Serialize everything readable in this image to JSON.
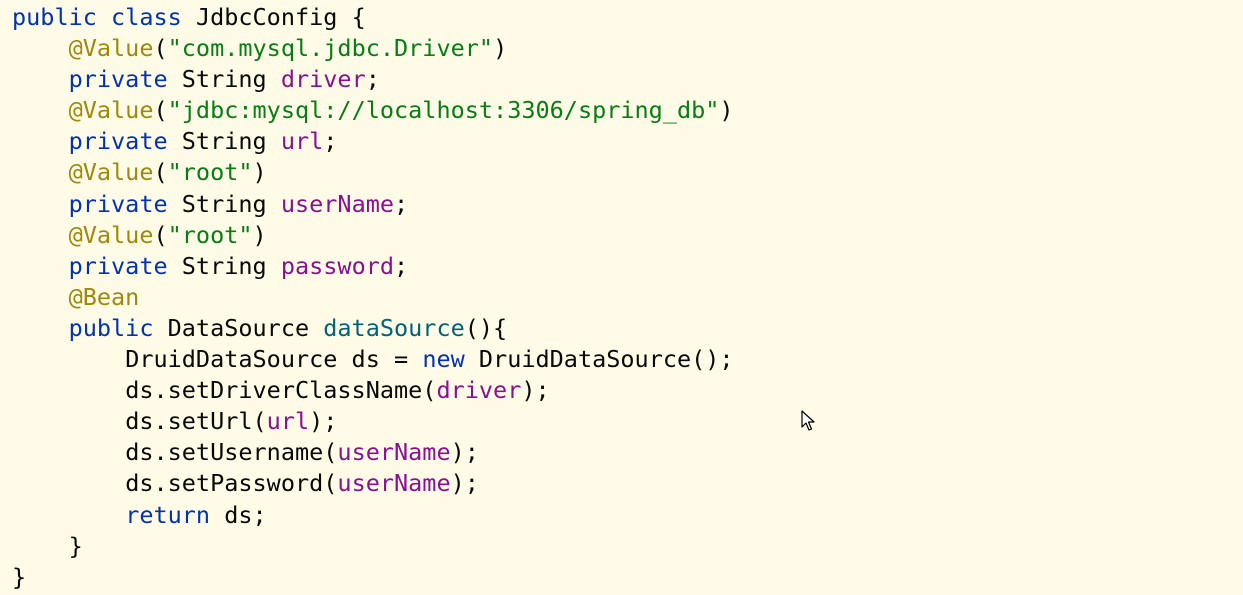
{
  "code_lines": [
    {
      "indent": "",
      "tokens": [
        {
          "t": "public",
          "c": "kw"
        },
        {
          "t": " ",
          "c": "plain"
        },
        {
          "t": "class",
          "c": "kw"
        },
        {
          "t": " JdbcConfig {",
          "c": "plain"
        }
      ]
    },
    {
      "indent": "    ",
      "tokens": [
        {
          "t": "@Value",
          "c": "ann"
        },
        {
          "t": "(",
          "c": "plain"
        },
        {
          "t": "\"com.mysql.jdbc.Driver\"",
          "c": "str"
        },
        {
          "t": ")",
          "c": "plain"
        }
      ]
    },
    {
      "indent": "    ",
      "tokens": [
        {
          "t": "private",
          "c": "kw"
        },
        {
          "t": " String ",
          "c": "plain"
        },
        {
          "t": "driver",
          "c": "fld"
        },
        {
          "t": ";",
          "c": "plain"
        }
      ]
    },
    {
      "indent": "    ",
      "tokens": [
        {
          "t": "@Value",
          "c": "ann"
        },
        {
          "t": "(",
          "c": "plain"
        },
        {
          "t": "\"jdbc:mysql://localhost:3306/spring_db\"",
          "c": "str"
        },
        {
          "t": ")",
          "c": "plain"
        }
      ]
    },
    {
      "indent": "    ",
      "tokens": [
        {
          "t": "private",
          "c": "kw"
        },
        {
          "t": " String ",
          "c": "plain"
        },
        {
          "t": "url",
          "c": "fld"
        },
        {
          "t": ";",
          "c": "plain"
        }
      ]
    },
    {
      "indent": "    ",
      "tokens": [
        {
          "t": "@Value",
          "c": "ann"
        },
        {
          "t": "(",
          "c": "plain"
        },
        {
          "t": "\"root\"",
          "c": "str"
        },
        {
          "t": ")",
          "c": "plain"
        }
      ]
    },
    {
      "indent": "    ",
      "tokens": [
        {
          "t": "private",
          "c": "kw"
        },
        {
          "t": " String ",
          "c": "plain"
        },
        {
          "t": "userName",
          "c": "fld"
        },
        {
          "t": ";",
          "c": "plain"
        }
      ]
    },
    {
      "indent": "    ",
      "tokens": [
        {
          "t": "@Value",
          "c": "ann"
        },
        {
          "t": "(",
          "c": "plain"
        },
        {
          "t": "\"root\"",
          "c": "str"
        },
        {
          "t": ")",
          "c": "plain"
        }
      ]
    },
    {
      "indent": "    ",
      "tokens": [
        {
          "t": "private",
          "c": "kw"
        },
        {
          "t": " String ",
          "c": "plain"
        },
        {
          "t": "password",
          "c": "fld"
        },
        {
          "t": ";",
          "c": "plain"
        }
      ]
    },
    {
      "indent": "    ",
      "tokens": [
        {
          "t": "@Bean",
          "c": "ann"
        }
      ]
    },
    {
      "indent": "    ",
      "tokens": [
        {
          "t": "public",
          "c": "kw"
        },
        {
          "t": " DataSource ",
          "c": "plain"
        },
        {
          "t": "dataSource",
          "c": "mth"
        },
        {
          "t": "(){",
          "c": "plain"
        }
      ]
    },
    {
      "indent": "        ",
      "tokens": [
        {
          "t": "DruidDataSource ds = ",
          "c": "plain"
        },
        {
          "t": "new",
          "c": "kw"
        },
        {
          "t": " DruidDataSource();",
          "c": "plain"
        }
      ]
    },
    {
      "indent": "        ",
      "tokens": [
        {
          "t": "ds.setDriverClassName(",
          "c": "plain"
        },
        {
          "t": "driver",
          "c": "fld"
        },
        {
          "t": ");",
          "c": "plain"
        }
      ]
    },
    {
      "indent": "        ",
      "tokens": [
        {
          "t": "ds.setUrl(",
          "c": "plain"
        },
        {
          "t": "url",
          "c": "fld"
        },
        {
          "t": ");",
          "c": "plain"
        }
      ]
    },
    {
      "indent": "        ",
      "tokens": [
        {
          "t": "ds.setUsername(",
          "c": "plain"
        },
        {
          "t": "userName",
          "c": "fld"
        },
        {
          "t": ");",
          "c": "plain"
        }
      ]
    },
    {
      "indent": "        ",
      "tokens": [
        {
          "t": "ds.setPassword(",
          "c": "plain"
        },
        {
          "t": "userName",
          "c": "fld"
        },
        {
          "t": ");",
          "c": "plain"
        }
      ]
    },
    {
      "indent": "        ",
      "tokens": [
        {
          "t": "return",
          "c": "kw"
        },
        {
          "t": " ds;",
          "c": "plain"
        }
      ]
    },
    {
      "indent": "    ",
      "tokens": [
        {
          "t": "}",
          "c": "plain"
        }
      ]
    },
    {
      "indent": "",
      "tokens": [
        {
          "t": "}",
          "c": "plain"
        }
      ]
    }
  ],
  "cursor_icon": "mouse-pointer-icon",
  "colors": {
    "background": "#fffbe6",
    "keyword": "#0033b3",
    "annotation": "#9e880d",
    "string": "#067d17",
    "field": "#871094",
    "method": "#00627a",
    "text": "#080808"
  }
}
